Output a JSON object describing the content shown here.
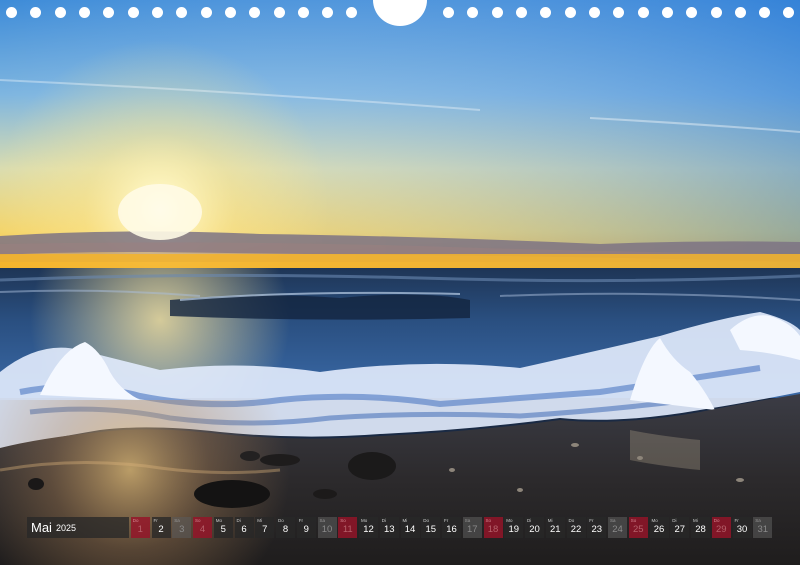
{
  "calendar": {
    "month": "Mai",
    "year": "2025",
    "days": [
      {
        "wd": "Do",
        "n": "1",
        "type": "holiday"
      },
      {
        "wd": "Fr",
        "n": "2",
        "type": "normal"
      },
      {
        "wd": "Sa",
        "n": "3",
        "type": "weekend"
      },
      {
        "wd": "So",
        "n": "4",
        "type": "holiday"
      },
      {
        "wd": "Mo",
        "n": "5",
        "type": "normal"
      },
      {
        "wd": "Di",
        "n": "6",
        "type": "normal"
      },
      {
        "wd": "Mi",
        "n": "7",
        "type": "normal"
      },
      {
        "wd": "Do",
        "n": "8",
        "type": "normal"
      },
      {
        "wd": "Fr",
        "n": "9",
        "type": "normal"
      },
      {
        "wd": "Sa",
        "n": "10",
        "type": "weekend"
      },
      {
        "wd": "So",
        "n": "11",
        "type": "holiday"
      },
      {
        "wd": "Mo",
        "n": "12",
        "type": "normal"
      },
      {
        "wd": "Di",
        "n": "13",
        "type": "normal"
      },
      {
        "wd": "Mi",
        "n": "14",
        "type": "normal"
      },
      {
        "wd": "Do",
        "n": "15",
        "type": "normal"
      },
      {
        "wd": "Fr",
        "n": "16",
        "type": "normal"
      },
      {
        "wd": "Sa",
        "n": "17",
        "type": "weekend"
      },
      {
        "wd": "So",
        "n": "18",
        "type": "holiday"
      },
      {
        "wd": "Mo",
        "n": "19",
        "type": "normal"
      },
      {
        "wd": "Di",
        "n": "20",
        "type": "normal"
      },
      {
        "wd": "Mi",
        "n": "21",
        "type": "normal"
      },
      {
        "wd": "Do",
        "n": "22",
        "type": "normal"
      },
      {
        "wd": "Fr",
        "n": "23",
        "type": "normal"
      },
      {
        "wd": "Sa",
        "n": "24",
        "type": "weekend"
      },
      {
        "wd": "So",
        "n": "25",
        "type": "holiday"
      },
      {
        "wd": "Mo",
        "n": "26",
        "type": "normal"
      },
      {
        "wd": "Di",
        "n": "27",
        "type": "normal"
      },
      {
        "wd": "Mi",
        "n": "28",
        "type": "normal"
      },
      {
        "wd": "Do",
        "n": "29",
        "type": "holiday"
      },
      {
        "wd": "Fr",
        "n": "30",
        "type": "normal"
      },
      {
        "wd": "Sa",
        "n": "31",
        "type": "weekend"
      }
    ]
  },
  "colors": {
    "sky_top": "#3f8fdc",
    "sun": "#fff6c8",
    "horizon_glow": "#f5b93a",
    "sea": "#22406a",
    "foam": "#eef4ff",
    "sand": "#3a3530",
    "holiday": "#96142a"
  }
}
